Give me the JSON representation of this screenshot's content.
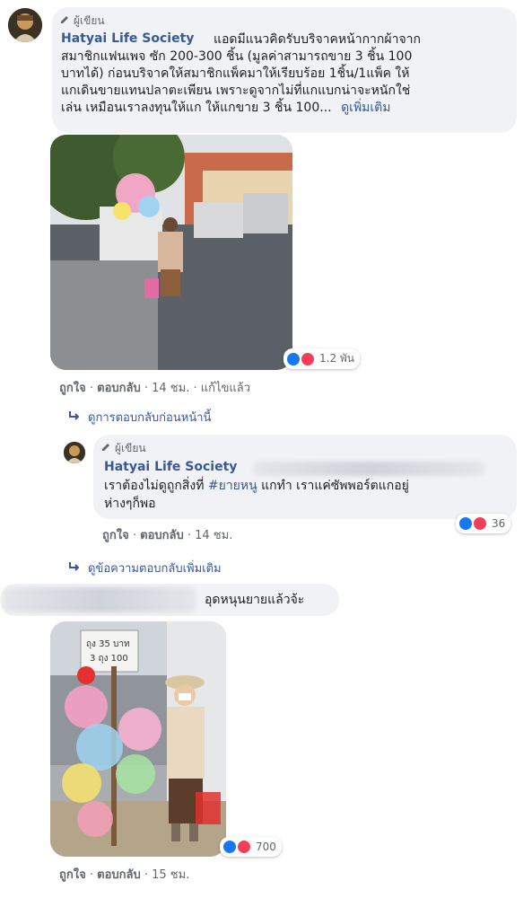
{
  "comment1": {
    "badge": "ผู้เขียน",
    "author": "Hatyai Life Society",
    "text_lines": [
      "แอดมีแนวคิดรับบริจาคหน้ากากผ้าจาก",
      "สมาชิกแฟนเพจ ซัก 200-300 ชิ้น (มูลค่าสามารถขาย 3 ชิ้น 100",
      "บาทได้) ก่อนบริจาคให้สมาชิกแพ็คมาให้เรียบร้อย 1ชิ้น/1แพ็ค ให้",
      "แกเดินขายแทนปลาตะเพียน เพราะดูจากไม่ที่แกแบกน่าจะหนักใช่",
      "เล่น เหมือนเราลงทุนให้แก ให้แกขาย 3 ชิ้น 100..."
    ],
    "see_more": "ดูเพิ่มเติม",
    "reaction_count": "1.2 พัน",
    "like": "ถูกใจ",
    "reply": "ตอบกลับ",
    "time": "14 ชม.",
    "edited": "แก้ไขแล้ว",
    "prev_replies": "ดูการตอบกลับก่อนหน้านี้"
  },
  "reply1": {
    "badge": "ผู้เขียน",
    "author": "Hatyai Life Society",
    "text_lines": [
      "เราต้องไม่ดูถูกสิ่งที่",
      "ห่างๆก็พอ"
    ],
    "hashtag": "#ยายหนู",
    "text_after_hashtag": " แกทำ เราแค่ซัพพอร์ตแกอยู่",
    "reaction_count": "36",
    "like": "ถูกใจ",
    "reply": "ตอบกลับ",
    "time": "14 ชม.",
    "more_replies": "ดูข้อความตอบกลับเพิ่มเติม"
  },
  "comment2": {
    "text": "อุดหนุนยายแล้วจ้ะ",
    "reaction_count": "700",
    "like": "ถูกใจ",
    "reply": "ตอบกลับ",
    "time": "15 ชม.",
    "sign_price": "ถุง 35 บาท",
    "sign_price2": "3 ถุง 100"
  },
  "colors": {
    "link": "#385898",
    "like": "#1877f2",
    "love": "#f33e58",
    "bubble": "#f0f2f5"
  }
}
